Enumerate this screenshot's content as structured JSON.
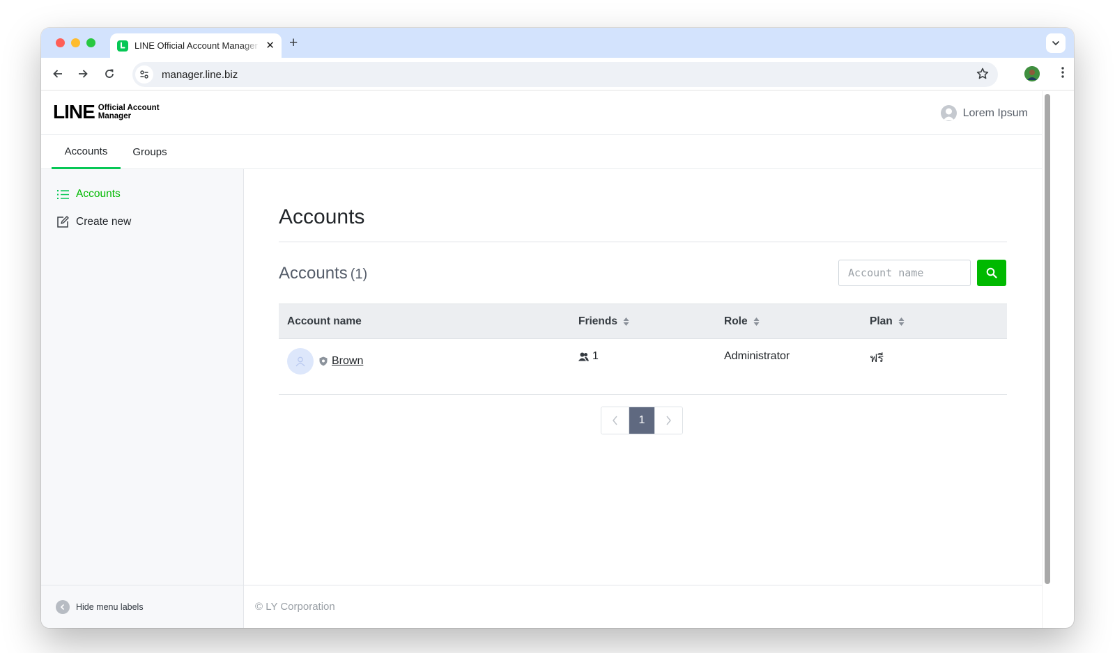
{
  "browser": {
    "tab_title": "LINE Official Account Manager",
    "tab_close": "✕",
    "new_tab": "+",
    "url": "manager.line.biz"
  },
  "app": {
    "logo_main": "LINE",
    "logo_sub_1": "Official Account",
    "logo_sub_2": "Manager",
    "user_name": "Lorem Ipsum",
    "accent_color": "#06c755",
    "button_color": "#00b900"
  },
  "top_tabs": [
    {
      "label": "Accounts",
      "active": true
    },
    {
      "label": "Groups",
      "active": false
    }
  ],
  "sidebar": {
    "items": [
      {
        "label": "Accounts",
        "icon": "list-icon",
        "active": true
      },
      {
        "label": "Create new",
        "icon": "edit-icon",
        "active": false
      }
    ],
    "footer_label": "Hide menu labels"
  },
  "main": {
    "page_title": "Accounts",
    "section_title": "Accounts",
    "section_count": "(1)",
    "search_placeholder": "Account name",
    "columns": [
      "Account name",
      "Friends",
      "Role",
      "Plan"
    ],
    "rows": [
      {
        "name": "Brown",
        "friends": "1",
        "role": "Administrator",
        "plan": "ฟรี"
      }
    ],
    "pagination": {
      "current_page": "1"
    },
    "footer": "© LY Corporation"
  }
}
